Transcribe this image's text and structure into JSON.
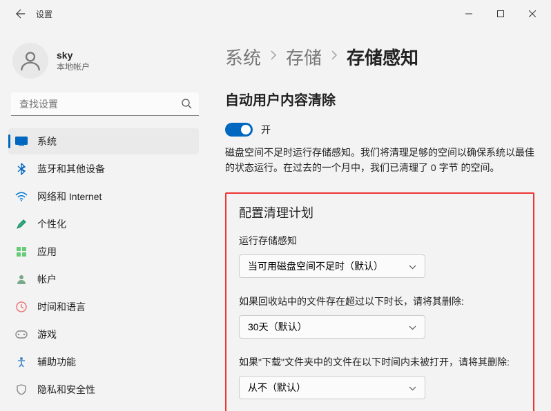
{
  "titlebar": {
    "title": "设置"
  },
  "profile": {
    "username": "sky",
    "account_type": "本地帐户"
  },
  "search": {
    "placeholder": "查找设置"
  },
  "nav": {
    "items": [
      {
        "label": "系统",
        "icon": "system"
      },
      {
        "label": "蓝牙和其他设备",
        "icon": "bluetooth"
      },
      {
        "label": "网络和 Internet",
        "icon": "wifi"
      },
      {
        "label": "个性化",
        "icon": "personalize"
      },
      {
        "label": "应用",
        "icon": "apps"
      },
      {
        "label": "帐户",
        "icon": "account"
      },
      {
        "label": "时间和语言",
        "icon": "time"
      },
      {
        "label": "游戏",
        "icon": "gaming"
      },
      {
        "label": "辅助功能",
        "icon": "accessibility"
      },
      {
        "label": "隐私和安全性",
        "icon": "privacy"
      }
    ],
    "active_index": 0
  },
  "breadcrumb": {
    "parts": [
      "系统",
      "存储",
      "存储感知"
    ]
  },
  "main": {
    "section_title": "自动用户内容清除",
    "toggle_state": "开",
    "description": "磁盘空间不足时运行存储感知。我们将清理足够的空间以确保系统以最佳的状态运行。在过去的一个月中，我们已清理了 0 字节 的空间。",
    "config": {
      "heading": "配置清理计划",
      "field1_label": "运行存储感知",
      "field1_value": "当可用磁盘空间不足时（默认）",
      "field2_label": "如果回收站中的文件存在超过以下时长，请将其删除:",
      "field2_value": "30天（默认）",
      "field3_label": "如果\"下载\"文件夹中的文件在以下时间内未被打开，请将其删除:",
      "field3_value": "从不（默认）"
    }
  }
}
